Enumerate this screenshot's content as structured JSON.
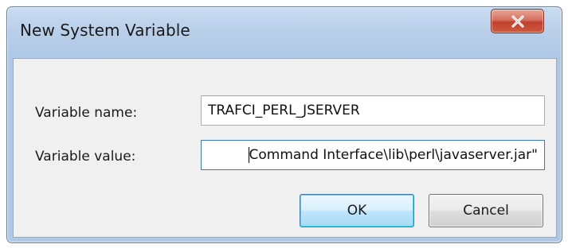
{
  "dialog": {
    "title": "New System Variable",
    "close_icon": "close-x-icon",
    "variable_name_label": "Variable name:",
    "variable_name_value": "TRAFCI_PERL_JSERVER",
    "variable_value_label": "Variable value:",
    "variable_value_visible_text": "Command Interface\\lib\\perl\\javaserver.jar\"",
    "ok_label": "OK",
    "cancel_label": "Cancel"
  },
  "colors": {
    "title_bar": "#b9cfe9",
    "close_button": "#c1402e",
    "client_background": "#f0f0f0",
    "default_button": "#bee6fd"
  }
}
